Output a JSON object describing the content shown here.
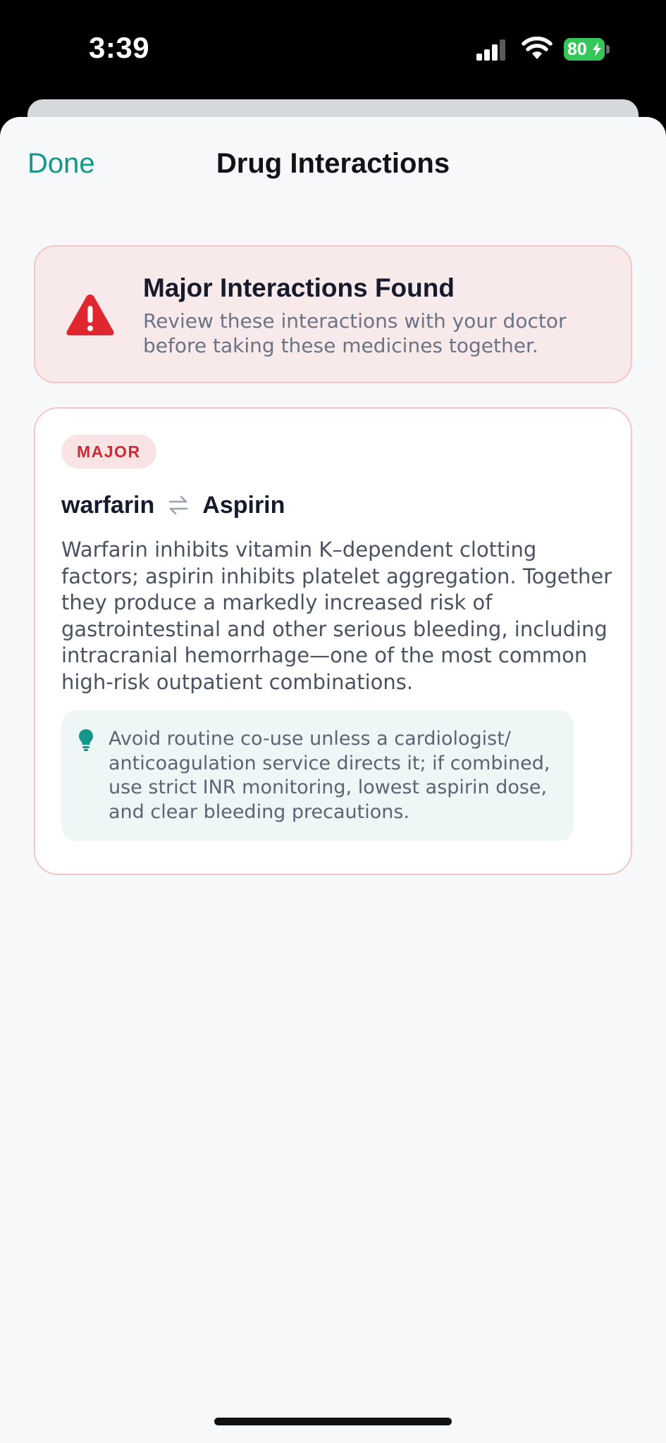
{
  "status_bar": {
    "time": "3:39",
    "battery_level": "80",
    "battery_charging": true,
    "icons": [
      "signal-icon",
      "wifi-icon",
      "battery-icon",
      "charging-bolt-icon"
    ]
  },
  "nav": {
    "done_label": "Done",
    "title": "Drug Interactions"
  },
  "alert": {
    "icon": "warning-triangle-icon",
    "title": "Major Interactions Found",
    "subtitle": "Review these interactions with your doctor before taking these medicines together."
  },
  "interaction": {
    "severity": "MAJOR",
    "drug_a": "warfarin",
    "drug_b": "Aspirin",
    "swap_icon": "swap-arrows-icon",
    "description": "Warfarin inhibits vitamin K–dependent clotting factors; aspirin inhibits platelet aggregation. Together they produce a markedly increased risk of gastrointestinal and other serious bleeding, including intracranial hemorrhage—one of the most common high-risk outpatient combinations.",
    "recommendation_icon": "lightbulb-icon",
    "recommendation": "Avoid routine co-use unless a cardiologist/ anticoagulation service directs it; if combined, use strict INR monitoring, lowest aspirin dose, and clear bleeding precautions."
  },
  "colors": {
    "accent": "#14978a",
    "danger": "#e0262e",
    "danger_bg": "#f8e9eb",
    "danger_border": "#f2c6cb",
    "tip_bg": "#eef7f5",
    "battery": "#34c759"
  }
}
